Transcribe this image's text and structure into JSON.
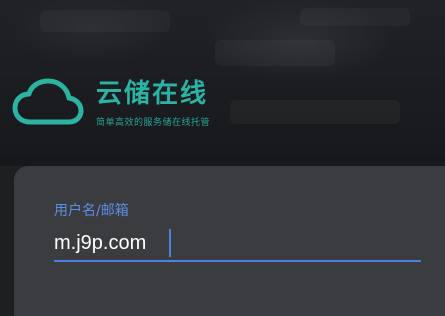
{
  "brand": {
    "name": "云储在线",
    "slogan": "简单高效的服务储在线托管",
    "accent_color": "#2bb3a3",
    "logo_icon": "cloud-icon"
  },
  "login": {
    "username_label": "用户名/邮箱",
    "username_value": "m.j9p.com",
    "accent_color": "#4f7fe0"
  }
}
